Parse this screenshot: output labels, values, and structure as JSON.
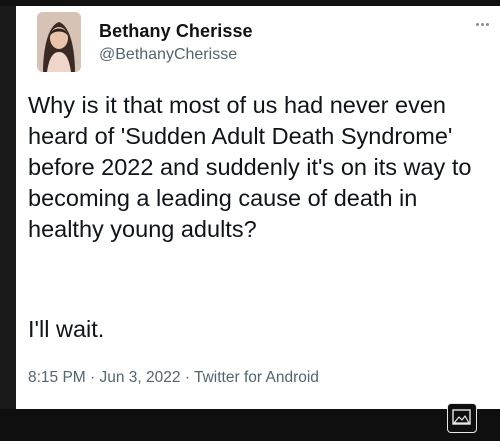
{
  "tweet": {
    "author_name": "Bethany Cherisse",
    "author_handle": "@BethanyCherisse",
    "text": "Why is it that most of us had never even heard of 'Sudden Adult Death Syndrome' before 2022 and suddenly it's on its way to becoming a leading cause of death in healthy young adults?",
    "closing": "I'll wait.",
    "timestamp": "8:15 PM · Jun 3, 2022 · Twitter for Android"
  },
  "icons": {
    "more": "more-options-icon",
    "avatar": "avatar",
    "image": "image-icon"
  },
  "colors": {
    "card_background": "#ffffff",
    "page_background": "#1a1a1a",
    "text_primary": "#0f1419",
    "text_secondary": "#536471"
  }
}
